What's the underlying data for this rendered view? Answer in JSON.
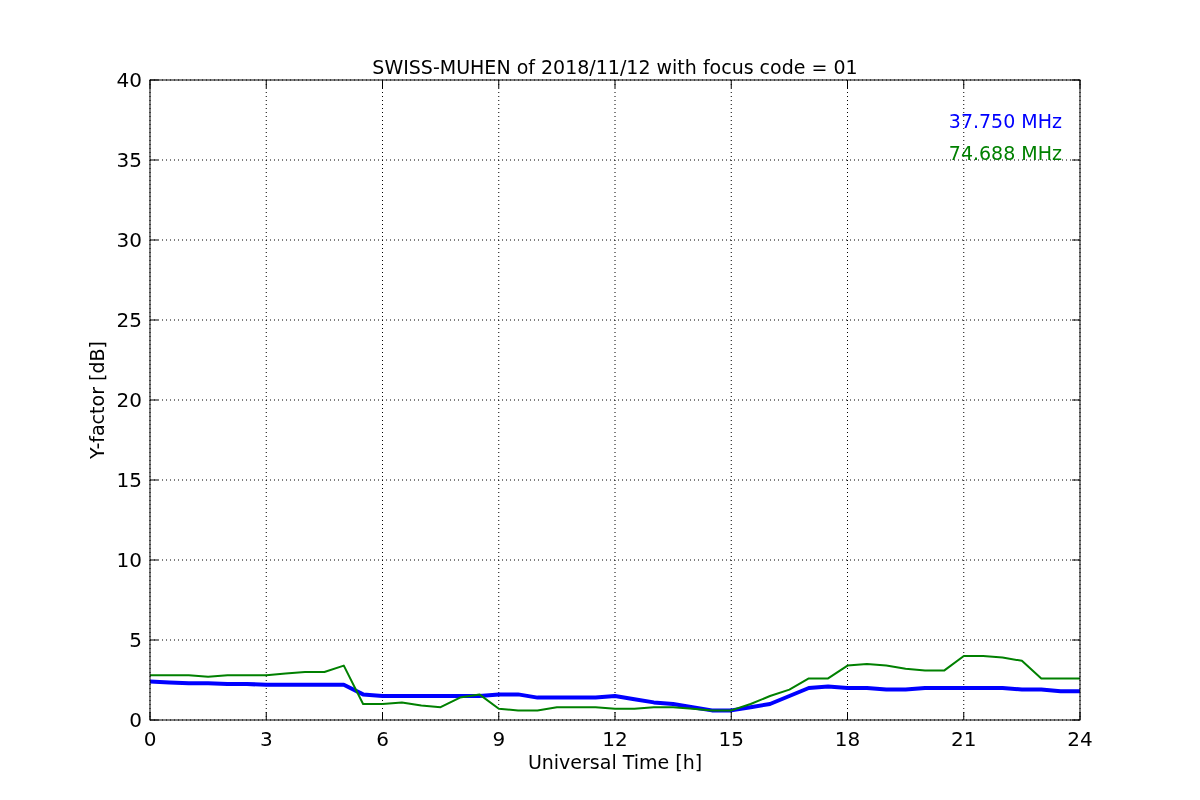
{
  "figure": {
    "chart_data": {
      "type": "line",
      "title": "SWISS-MUHEN of 2018/11/12 with focus code = 01",
      "xlabel": "Universal Time [h]",
      "ylabel": "Y-factor [dB]",
      "x": [
        0,
        0.5,
        1,
        1.5,
        2,
        2.5,
        3,
        3.5,
        4,
        4.5,
        5,
        5.5,
        6,
        6.5,
        7,
        7.5,
        8,
        8.5,
        9,
        9.5,
        10,
        10.5,
        11,
        11.5,
        12,
        12.5,
        13,
        13.5,
        14,
        14.5,
        15,
        15.5,
        16,
        16.5,
        17,
        17.5,
        18,
        18.5,
        19,
        19.5,
        20,
        20.5,
        21,
        21.5,
        22,
        22.5,
        23,
        23.5,
        24
      ],
      "series": [
        {
          "name": "37.750 MHz",
          "color": "#0000ff",
          "values": [
            2.4,
            2.35,
            2.3,
            2.3,
            2.25,
            2.25,
            2.2,
            2.2,
            2.2,
            2.2,
            2.2,
            1.6,
            1.5,
            1.5,
            1.5,
            1.5,
            1.5,
            1.5,
            1.6,
            1.6,
            1.4,
            1.4,
            1.4,
            1.4,
            1.5,
            1.3,
            1.1,
            1.0,
            0.8,
            0.6,
            0.6,
            0.8,
            1.0,
            1.5,
            2.0,
            2.1,
            2.0,
            2.0,
            1.9,
            1.9,
            2.0,
            2.0,
            2.0,
            2.0,
            2.0,
            1.9,
            1.9,
            1.8,
            1.8
          ]
        },
        {
          "name": "74.688 MHz",
          "color": "#008000",
          "values": [
            2.8,
            2.8,
            2.8,
            2.7,
            2.8,
            2.8,
            2.8,
            2.9,
            3.0,
            3.0,
            3.4,
            1.0,
            1.0,
            1.1,
            0.9,
            0.8,
            1.4,
            1.6,
            0.7,
            0.6,
            0.6,
            0.8,
            0.8,
            0.8,
            0.7,
            0.7,
            0.8,
            0.8,
            0.7,
            0.6,
            0.6,
            1.0,
            1.5,
            1.9,
            2.6,
            2.6,
            3.4,
            3.5,
            3.4,
            3.2,
            3.1,
            3.1,
            4.0,
            4.0,
            3.9,
            3.7,
            2.6,
            2.6,
            2.6
          ]
        }
      ],
      "grid": true,
      "xlim": [
        0,
        24
      ],
      "ylim": [
        0,
        40
      ],
      "xticks": [
        0,
        3,
        6,
        9,
        12,
        15,
        18,
        21,
        24
      ],
      "yticks": [
        0,
        5,
        10,
        15,
        20,
        25,
        30,
        35,
        40
      ]
    }
  }
}
